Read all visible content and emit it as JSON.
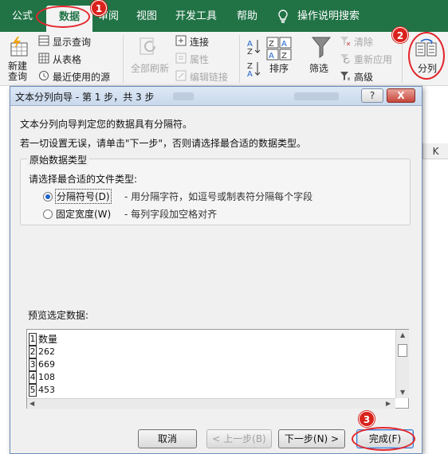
{
  "ribbon_tabs": [
    "公式",
    "数据",
    "审阅",
    "视图",
    "开发工具",
    "帮助",
    "操作说明搜索"
  ],
  "ribbon": {
    "new_query": "新建\n查询",
    "new_query_1": "新建",
    "new_query_2": "查询",
    "show_query": "显示查询",
    "from_table": "从表格",
    "recent_sources": "最近使用的源",
    "refresh_all": "全部刷新",
    "connections": "连接",
    "properties": "属性",
    "edit_links": "编辑链接",
    "sort": "排序",
    "filter": "筛选",
    "clear": "清除",
    "reapply": "重新应用",
    "advanced": "高级",
    "split": "分列"
  },
  "badges": [
    "1",
    "2",
    "3"
  ],
  "sheet": {
    "column_label": "K"
  },
  "dialog": {
    "title": "文本分列向导 - 第 1 步，共 3 步",
    "help_button": "?",
    "close_button": "X",
    "intro": "文本分列向导判定您的数据具有分隔符。",
    "instruction": "若一切设置无误，请单击\"下一步\"，否则请选择最合适的数据类型。",
    "group_title": "原始数据类型",
    "group_prompt": "请选择最合适的文件类型:",
    "options": [
      {
        "label": "分隔符号(D)",
        "desc": "- 用分隔字符，如逗号或制表符分隔每个字段",
        "selected": true
      },
      {
        "label": "固定宽度(W)",
        "desc": "- 每列字段加空格对齐",
        "selected": false
      }
    ],
    "preview_label": "预览选定数据:",
    "preview_rows": [
      {
        "n": "1",
        "v": "数量"
      },
      {
        "n": "2",
        "v": "262"
      },
      {
        "n": "3",
        "v": "669"
      },
      {
        "n": "4",
        "v": "108"
      },
      {
        "n": "5",
        "v": "453"
      }
    ],
    "buttons": {
      "cancel": "取消",
      "back": "< 上一步(B)",
      "next": "下一步(N) >",
      "finish": "完成(F)"
    }
  },
  "colors": {
    "ribbon_green": "#217346",
    "annotation_red": "#d9221c"
  }
}
